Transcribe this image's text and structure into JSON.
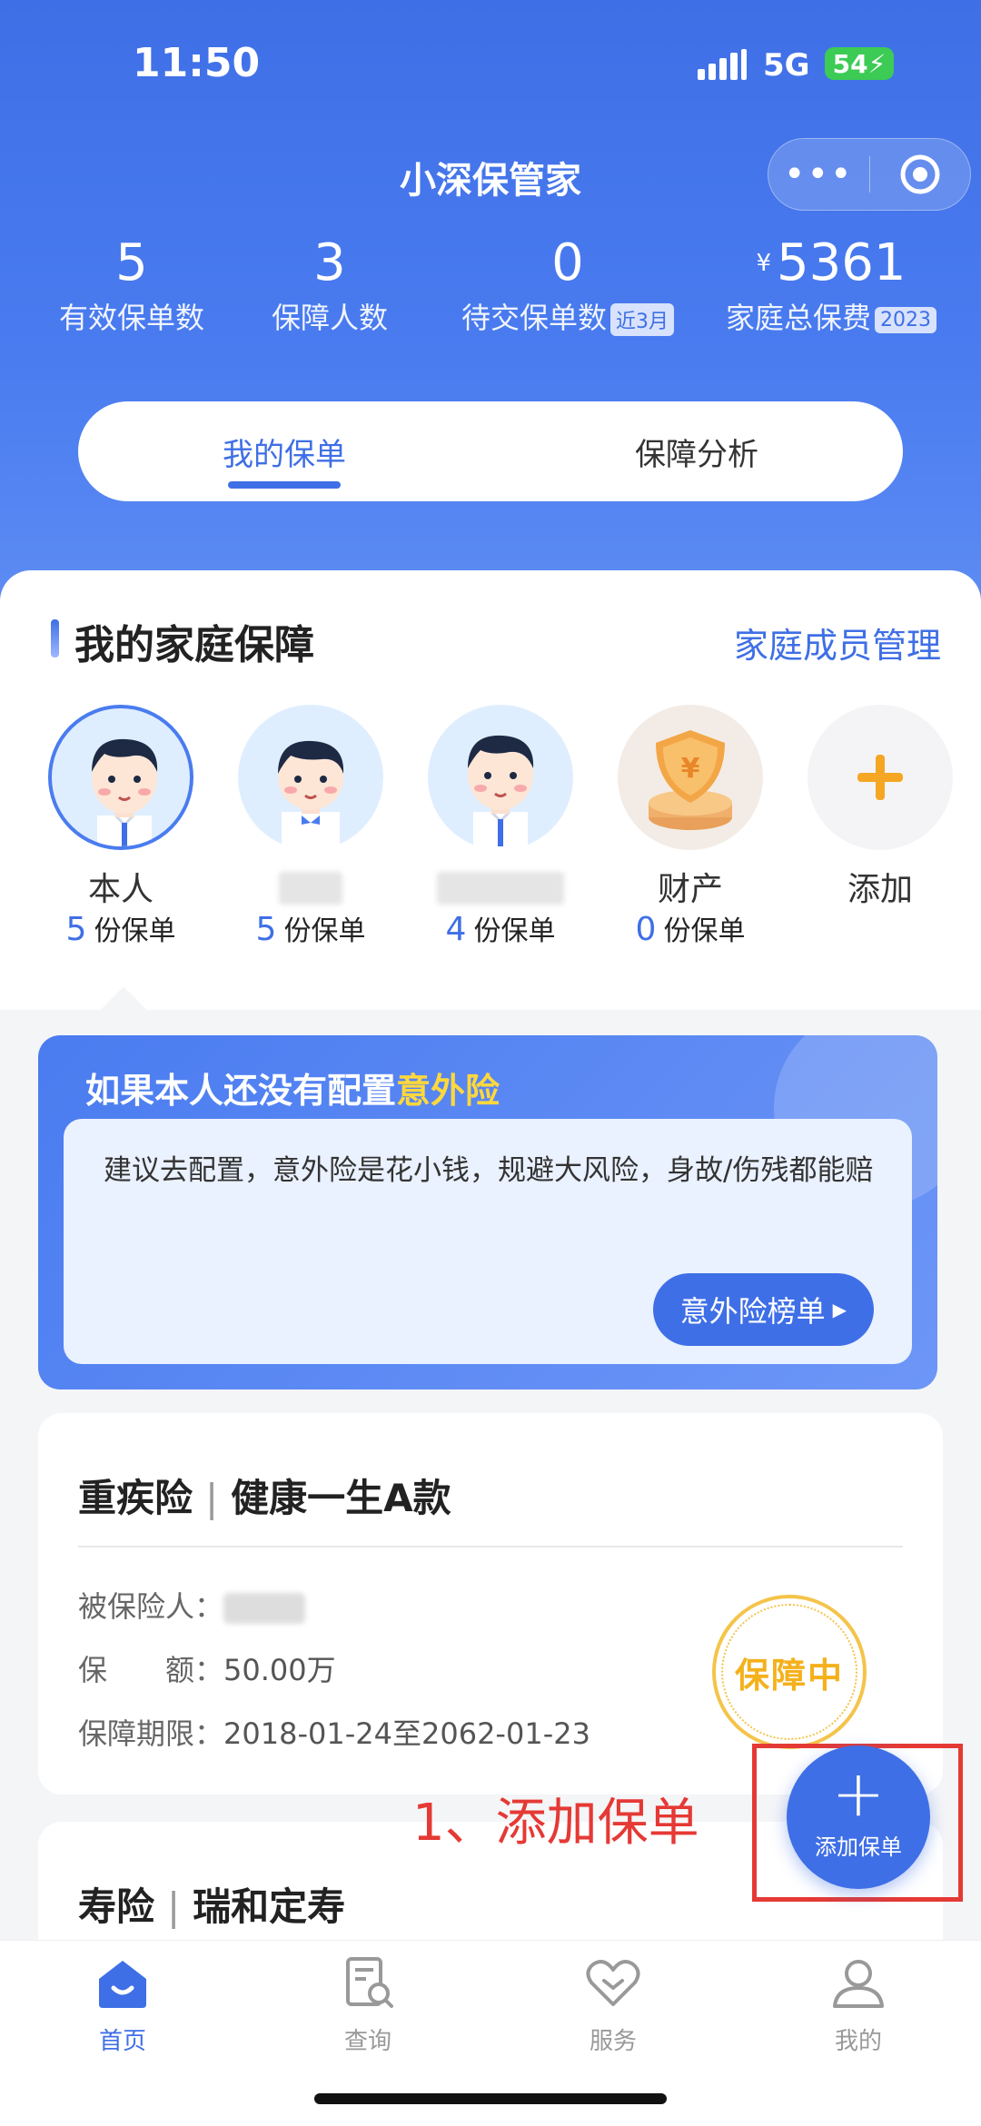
{
  "status": {
    "time": "11:50",
    "network": "5G",
    "battery": "54"
  },
  "header": {
    "title": "小深保管家",
    "capsule_more": "•••"
  },
  "stats": [
    {
      "value": "5",
      "label": "有效保单数",
      "tag": ""
    },
    {
      "value": "3",
      "label": "保障人数",
      "tag": ""
    },
    {
      "value": "0",
      "label": "待交保单数",
      "tag": "近3月"
    },
    {
      "currency": "¥",
      "value": "5361",
      "label": "家庭总保费",
      "tag": "2023"
    }
  ],
  "tabs": [
    {
      "label": "我的保单"
    },
    {
      "label": "保障分析"
    }
  ],
  "family": {
    "title": "我的家庭保障",
    "manage": "家庭成员管理",
    "members": [
      {
        "name": "本人",
        "count": "5",
        "unit": "份保单"
      },
      {
        "name": "",
        "count": "5",
        "unit": "份保单"
      },
      {
        "name": "",
        "count": "4",
        "unit": "份保单"
      },
      {
        "name": "财产",
        "count": "0",
        "unit": "份保单"
      },
      {
        "name": "添加"
      }
    ]
  },
  "alert": {
    "head_prefix": "如果本人还没有配置",
    "head_highlight": "意外险",
    "body": "建议去配置，意外险是花小钱，规避大风险，身故/伤残都能赔",
    "button": "意外险榜单"
  },
  "policies": [
    {
      "type": "重疾险",
      "sep": "|",
      "name": "健康一生A款",
      "insured_label": "被保险人：",
      "amount_label": "保　　额：",
      "amount": "50.00万",
      "period_label": "保障期限：",
      "period": "2018-01-24至2062-01-23",
      "status": "保障中"
    },
    {
      "type": "寿险",
      "sep": "|",
      "name": "瑞和定寿"
    }
  ],
  "annotation": "1、添加保单",
  "fab": {
    "plus": "+",
    "label": "添加保单"
  },
  "tabbar": [
    {
      "label": "首页",
      "icon": "home-icon"
    },
    {
      "label": "查询",
      "icon": "search-doc-icon"
    },
    {
      "label": "服务",
      "icon": "heart-icon"
    },
    {
      "label": "我的",
      "icon": "user-icon"
    }
  ],
  "colors": {
    "primary": "#3f6fe6",
    "highlight": "#ffd83c",
    "annotation": "#e53935",
    "stamp": "#f4b11c"
  }
}
